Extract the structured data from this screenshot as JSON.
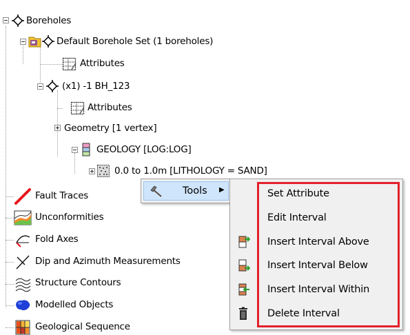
{
  "tree": {
    "boreholes": "Boreholes",
    "default_set": "Default Borehole Set (1 boreholes)",
    "set_attributes": "Attributes",
    "borehole": "(x1) -1 BH_123",
    "borehole_attributes": "Attributes",
    "geometry": "Geometry  [1 vertex]",
    "geology": "GEOLOGY  [LOG:LOG]",
    "interval": "0.0 to 1.0m  [LITHOLOGY = SAND]",
    "fault_traces": "Fault Traces",
    "unconformities": "Unconformities",
    "fold_axes": "Fold Axes",
    "dip_azimuth": "Dip and Azimuth Measurements",
    "structure_contours": "Structure Contours",
    "modelled_objects": "Modelled Objects",
    "geological_sequence": "Geological Sequence"
  },
  "context_menu": {
    "tools_label": "Tools",
    "tools_icon": "hammer-icon",
    "submenu_arrow": "▶"
  },
  "tools_submenu": {
    "items": [
      {
        "label": "Set Attribute",
        "icon": null
      },
      {
        "label": "Edit Interval",
        "icon": null
      },
      {
        "label": "Insert Interval Above",
        "icon": "insert-above-icon"
      },
      {
        "label": "Insert Interval Below",
        "icon": "insert-below-icon"
      },
      {
        "label": "Insert Interval Within",
        "icon": "insert-within-icon"
      },
      {
        "label": "Delete Interval",
        "icon": "trash-icon"
      }
    ]
  },
  "colors": {
    "highlight_border": "#e3202a",
    "menu_hover": "#cfe5fb",
    "fault_red": "#e8141b",
    "folder_yellow": "#f2c230"
  }
}
